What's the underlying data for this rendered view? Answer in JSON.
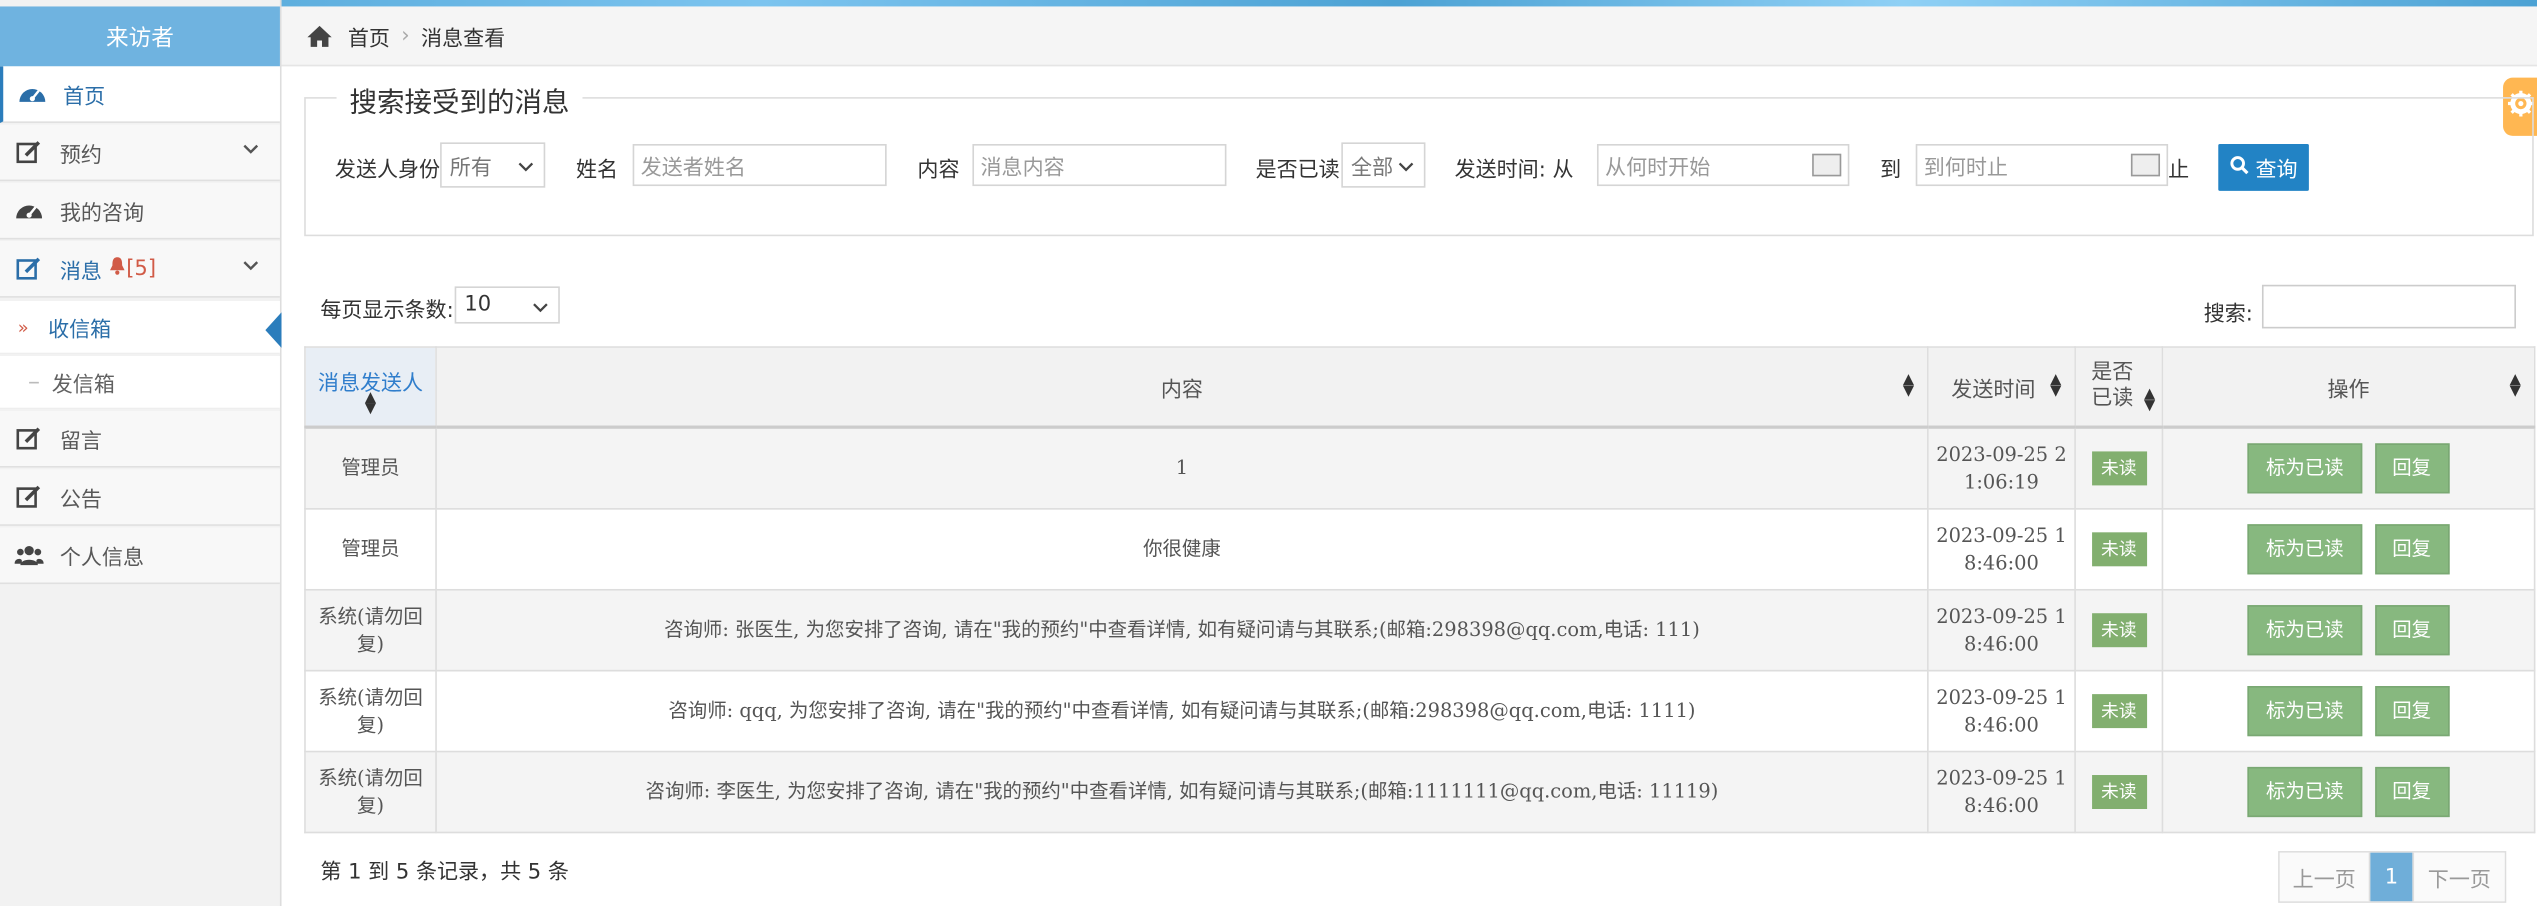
{
  "app": {
    "role_title": "来访者"
  },
  "sidebar": {
    "items": [
      {
        "label": "首页",
        "icon": "dashboard-icon"
      },
      {
        "label": "预约",
        "icon": "edit-icon",
        "has_chevron": true
      },
      {
        "label": "我的咨询",
        "icon": "dashboard-icon"
      },
      {
        "label": "消息",
        "icon": "edit-icon",
        "badge": "[5]",
        "has_chevron": true
      },
      {
        "label": "留言",
        "icon": "edit-icon"
      },
      {
        "label": "公告",
        "icon": "edit-icon"
      },
      {
        "label": "个人信息",
        "icon": "users-icon"
      }
    ],
    "sub_items": [
      {
        "label": "收信箱",
        "active": true
      },
      {
        "label": "发信箱"
      }
    ]
  },
  "breadcrumb": {
    "home": "首页",
    "current": "消息查看"
  },
  "search": {
    "title": "搜索接受到的消息",
    "sender_identity_label": "发送人身份",
    "sender_identity_value": "所有",
    "name_label": "姓名",
    "name_placeholder": "发送者姓名",
    "content_label": "内容",
    "content_placeholder": "消息内容",
    "read_label": "是否已读",
    "read_value": "全部",
    "time_label": "发送时间: 从",
    "time_from_placeholder": "从何时开始",
    "to_label": "到",
    "time_to_placeholder": "到何时止",
    "end_label": "止",
    "query_label": "查询"
  },
  "table_controls": {
    "per_page_label": "每页显示条数:",
    "per_page_value": "10",
    "search_label": "搜索:"
  },
  "table": {
    "columns": [
      "消息发送人",
      "内容",
      "发送时间",
      "是否已读",
      "操作"
    ],
    "rows": [
      {
        "sender": "管理员",
        "content": "1",
        "time": "2023-09-25 21:06:19",
        "read": "未读"
      },
      {
        "sender": "管理员",
        "content": "你很健康",
        "time": "2023-09-25 18:46:00",
        "read": "未读"
      },
      {
        "sender": "系统(请勿回复)",
        "content": "咨询师: 张医生, 为您安排了咨询, 请在\"我的预约\"中查看详情, 如有疑问请与其联系;(邮箱:298398@qq.com,电话: 111)",
        "time": "2023-09-25 18:46:00",
        "read": "未读"
      },
      {
        "sender": "系统(请勿回复)",
        "content": "咨询师: qqq, 为您安排了咨询, 请在\"我的预约\"中查看详情, 如有疑问请与其联系;(邮箱:298398@qq.com,电话: 1111)",
        "time": "2023-09-25 18:46:00",
        "read": "未读"
      },
      {
        "sender": "系统(请勿回复)",
        "content": "咨询师: 李医生, 为您安排了咨询, 请在\"我的预约\"中查看详情, 如有疑问请与其联系;(邮箱:1111111@qq.com,电话: 11119)",
        "time": "2023-09-25 18:46:00",
        "read": "未读"
      }
    ],
    "mark_read_label": "标为已读",
    "reply_label": "回复"
  },
  "footer": {
    "info": "第 1 到 5 条记录，共 5 条",
    "prev": "上一页",
    "page": "1",
    "next": "下一页"
  },
  "colors": {
    "accent": "#2283c5",
    "header": "#6fb3e0",
    "success": "#87b87f",
    "settings_tab": "#ffb752"
  }
}
